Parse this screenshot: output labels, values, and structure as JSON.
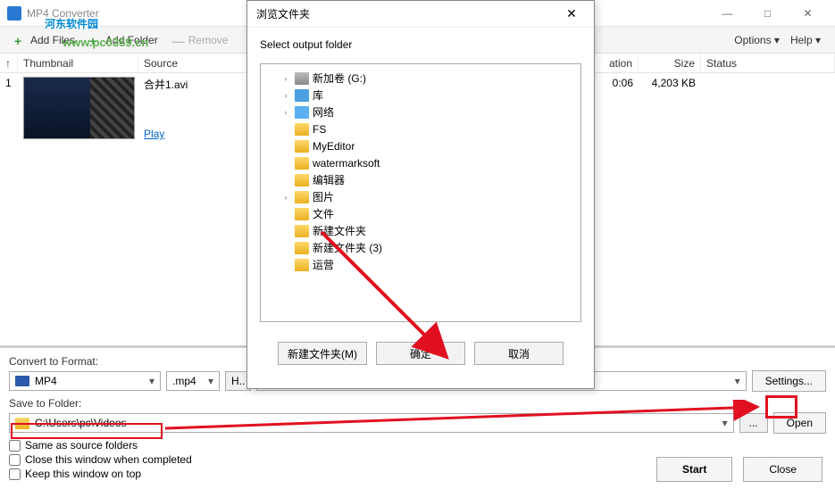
{
  "window": {
    "title": "MP4 Converter"
  },
  "toolbar": {
    "add_files": "Add Files",
    "add_folder": "Add Folder",
    "remove": "Remove",
    "options": "Options  ▾",
    "help": "Help  ▾"
  },
  "watermark": {
    "text_cn": "河东软件园",
    "url": "www.pc0359.cn"
  },
  "columns": {
    "idx": "↑",
    "thumbnail": "Thumbnail",
    "source": "Source",
    "duration": "ation",
    "size": "Size",
    "status": "Status"
  },
  "files": [
    {
      "idx": "1",
      "source": "合并1.avi",
      "play": "Play",
      "duration": "0:06",
      "size": "4,203 KB",
      "status": ""
    }
  ],
  "convert": {
    "label": "Convert to Format:",
    "format_name": "MP4",
    "format_ext": ".mp4",
    "hbtn": "H..",
    "settings": "Settings..."
  },
  "save": {
    "label": "Save to Folder:",
    "path": "C:\\Users\\pc\\Videos",
    "browse": "...",
    "open": "Open",
    "same_as_source": "Same as source folders"
  },
  "checks": {
    "close_when_done": "Close this window when completed",
    "keep_on_top": "Keep this window on top"
  },
  "footer": {
    "start": "Start",
    "close": "Close"
  },
  "dialog": {
    "title": "浏览文件夹",
    "prompt": "Select output folder",
    "tree": [
      {
        "exp": "›",
        "icon": "drive",
        "label": "新加卷 (G:)"
      },
      {
        "exp": "›",
        "icon": "lib",
        "label": "库"
      },
      {
        "exp": "›",
        "icon": "net",
        "label": "网络"
      },
      {
        "exp": "",
        "icon": "folder",
        "label": "FS"
      },
      {
        "exp": "",
        "icon": "folder",
        "label": "MyEditor"
      },
      {
        "exp": "",
        "icon": "folder",
        "label": "watermarksoft"
      },
      {
        "exp": "",
        "icon": "folder",
        "label": "编辑器"
      },
      {
        "exp": "›",
        "icon": "folder",
        "label": "图片"
      },
      {
        "exp": "",
        "icon": "folder",
        "label": "文件"
      },
      {
        "exp": "",
        "icon": "folder",
        "label": "新建文件夹"
      },
      {
        "exp": "",
        "icon": "folder",
        "label": "新建文件夹 (3)"
      },
      {
        "exp": "",
        "icon": "folder",
        "label": "运营"
      }
    ],
    "new_folder": "新建文件夹(M)",
    "ok": "确定",
    "cancel": "取消"
  }
}
